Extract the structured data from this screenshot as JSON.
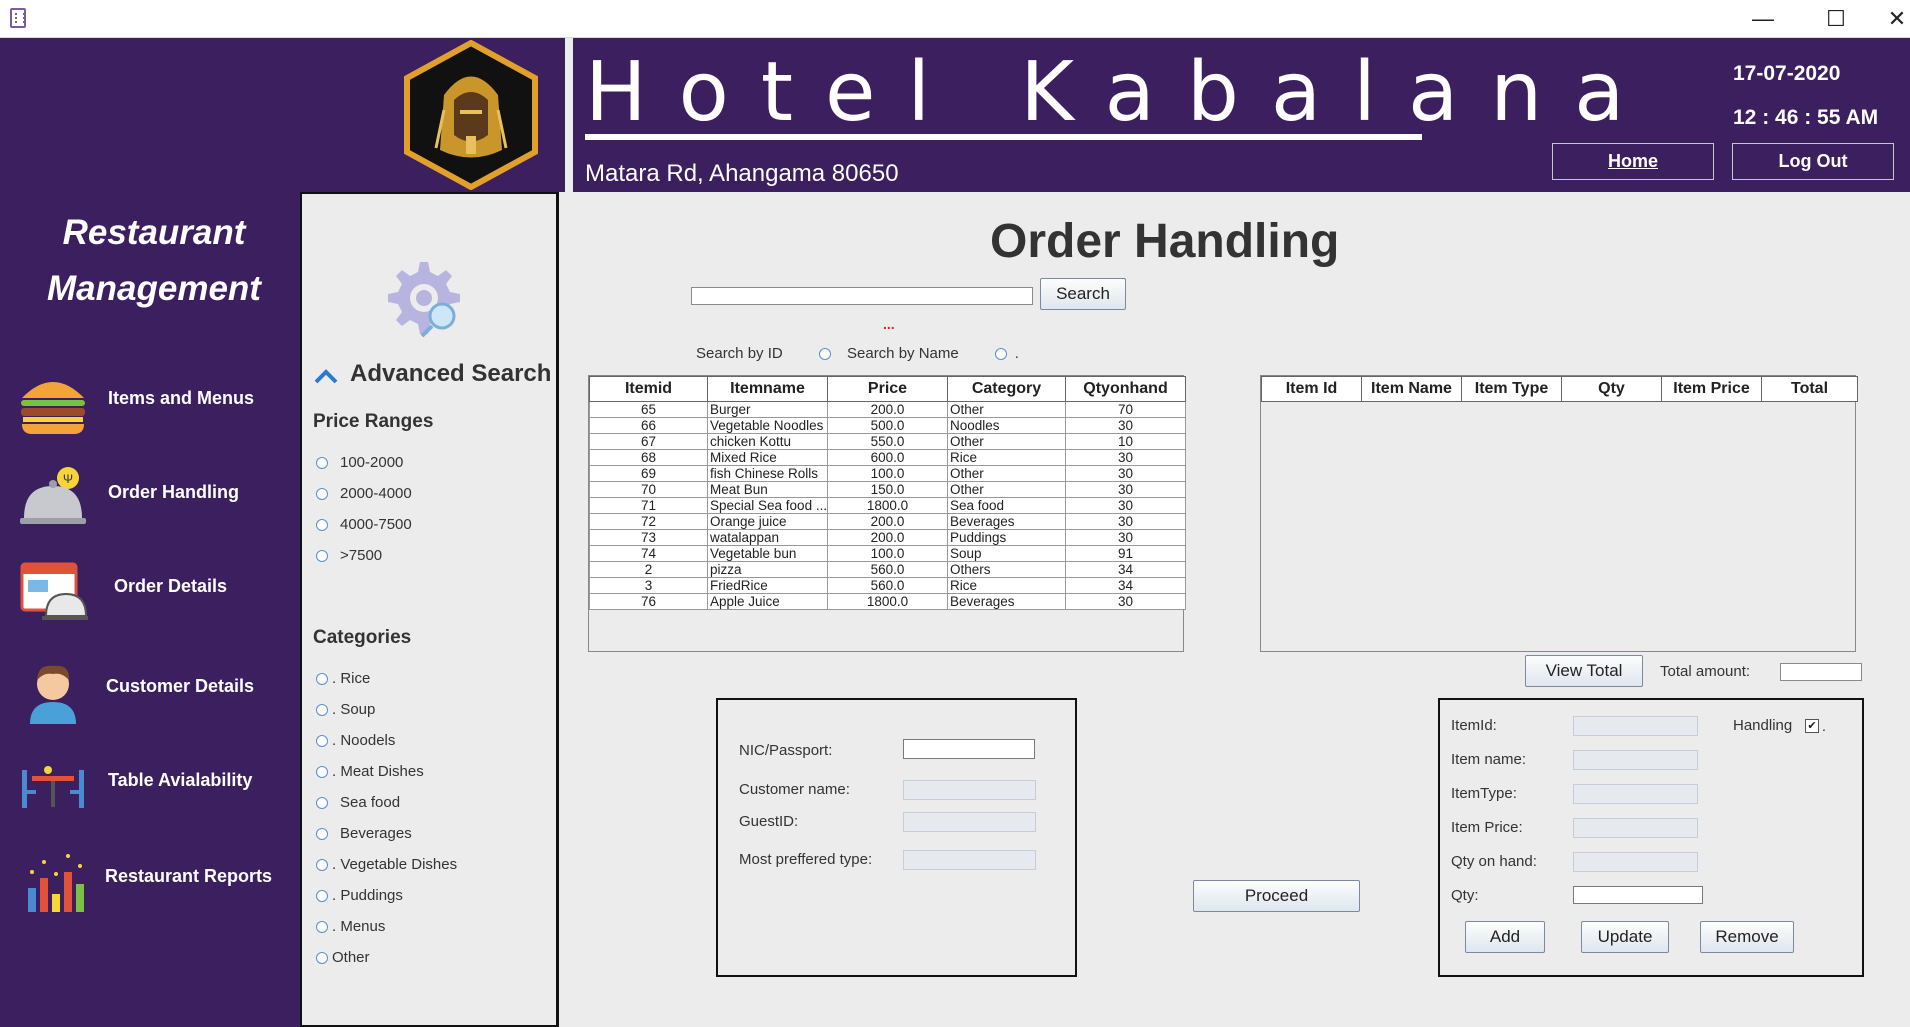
{
  "window": {
    "minimize": "—",
    "maximize": "☐",
    "close": "✕"
  },
  "header": {
    "hotel_name": "Hotel Kabalana",
    "address": "Matara Rd, Ahangama 80650",
    "date": "17-07-2020",
    "time": "12 : 46 : 55 AM",
    "home_label": "Home",
    "logout_label": "Log Out"
  },
  "sidebar": {
    "title_line1": "Restaurant",
    "title_line2": "Management",
    "items": [
      {
        "label": "Items and Menus",
        "icon": "burger-icon"
      },
      {
        "label": "Order Handling",
        "icon": "cloche-icon"
      },
      {
        "label": "Order Details",
        "icon": "order-details-icon"
      },
      {
        "label": "Customer Details",
        "icon": "customer-icon"
      },
      {
        "label": "Table Avialability",
        "icon": "table-icon"
      },
      {
        "label": "Restaurant Reports",
        "icon": "bar-chart-icon"
      }
    ]
  },
  "advanced": {
    "title": "Advanced Search",
    "price_heading": "Price Ranges",
    "prices": [
      "100-2000",
      "2000-4000",
      "4000-7500",
      ">7500"
    ],
    "cat_heading": "Categories",
    "categories": [
      ". Rice",
      ". Soup",
      ". Noodels",
      ". Meat Dishes",
      "Sea food",
      "Beverages",
      ". Vegetable Dishes",
      ". Puddings",
      ". Menus",
      "Other"
    ]
  },
  "main": {
    "title": "Order Handling",
    "search_value": "",
    "search_label": "Search",
    "hint": "...",
    "search_by_id": "Search by ID",
    "search_by_name": "Search by Name",
    "search_by_name_suffix": "."
  },
  "items_table": {
    "columns": [
      "Itemid",
      "Itemname",
      "Price",
      "Category",
      "Qtyonhand"
    ],
    "rows": [
      [
        "65",
        "Burger",
        "200.0",
        "Other",
        "70"
      ],
      [
        "66",
        "Vegetable Noodles",
        "500.0",
        "Noodles",
        "30"
      ],
      [
        "67",
        "chicken Kottu",
        "550.0",
        "Other",
        "10"
      ],
      [
        "68",
        "Mixed Rice",
        "600.0",
        "Rice",
        "30"
      ],
      [
        "69",
        "fish Chinese Rolls",
        "100.0",
        "Other",
        "30"
      ],
      [
        "70",
        "Meat Bun",
        "150.0",
        "Other",
        "30"
      ],
      [
        "71",
        "Special Sea food ...",
        "1800.0",
        "Sea food",
        "30"
      ],
      [
        "72",
        "Orange juice",
        "200.0",
        "Beverages",
        "30"
      ],
      [
        "73",
        "watalappan",
        "200.0",
        "Puddings",
        "30"
      ],
      [
        "74",
        "Vegetable bun",
        "100.0",
        "Soup",
        "91"
      ],
      [
        "2",
        "pizza",
        "560.0",
        "Others",
        "34"
      ],
      [
        "3",
        "FriedRice",
        "560.0",
        "Rice",
        "34"
      ],
      [
        "76",
        "Apple Juice",
        "1800.0",
        "Beverages",
        "30"
      ]
    ]
  },
  "order_table": {
    "columns": [
      "Item Id",
      "Item Name",
      "Item Type",
      "Qty",
      "Item Price",
      "Total"
    ]
  },
  "totals": {
    "view_total_label": "View Total",
    "total_amount_label": "Total amount:",
    "total_amount_value": ""
  },
  "customer": {
    "nic_label": "NIC/Passport:",
    "name_label": "Customer name:",
    "guest_label": "GuestID:",
    "pref_label": "Most preffered type:"
  },
  "proceed_label": "Proceed",
  "item_form": {
    "itemid_label": "ItemId:",
    "name_label": "Item   name:",
    "type_label": "ItemType:",
    "price_label": "Item Price:",
    "qoh_label": "Qty on hand:",
    "qty_label": "Qty:",
    "handling_label": "Handling",
    "handling_checked": "✔",
    "handling_suffix": ".",
    "add_label": "Add",
    "update_label": "Update",
    "remove_label": "Remove"
  },
  "colors": {
    "sidebar": "#3b1f5f",
    "background": "#ececec"
  }
}
